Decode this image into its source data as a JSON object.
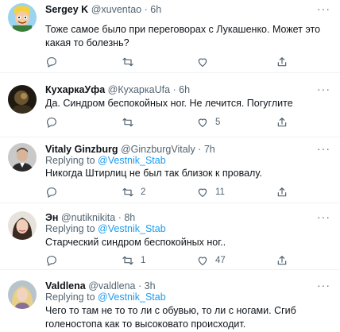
{
  "tweets": [
    {
      "name": "Sergey K",
      "handle": "@xuventao",
      "time": "6h",
      "replying_prefix": null,
      "replying_to": null,
      "text": "Тоже самое было при переговорах с Лукашенко. Может это какая то болезнь?",
      "avatar_icon": "cartoon-avatar",
      "counts": {
        "replies": "",
        "retweets": "",
        "likes": ""
      }
    },
    {
      "name": "КухаркаУфа",
      "handle": "@КухаркаUfa",
      "time": "6h",
      "replying_prefix": null,
      "replying_to": null,
      "text": "Да. Синдром беспокойных ног. Не лечится. Погуглите",
      "avatar_icon": "dark-photo-avatar",
      "counts": {
        "replies": "",
        "retweets": "",
        "likes": "5"
      }
    },
    {
      "name": "Vitaly Ginzburg",
      "handle": "@GinzburgVitaly",
      "time": "7h",
      "replying_prefix": "Replying to",
      "replying_to": "@Vestnik_Stab",
      "text": "Никогда Штирлиц не был так близок к провалу.",
      "avatar_icon": "man-photo-avatar",
      "counts": {
        "replies": "",
        "retweets": "2",
        "likes": "11"
      }
    },
    {
      "name": "Эн",
      "handle": "@nutiknikita",
      "time": "8h",
      "replying_prefix": "Replying to",
      "replying_to": "@Vestnik_Stab",
      "text": "Старческий синдром беспокойных ног..",
      "avatar_icon": "woman-photo-avatar",
      "counts": {
        "replies": "",
        "retweets": "1",
        "likes": "47"
      }
    },
    {
      "name": "Valdlena",
      "handle": "@valdlena",
      "time": "3h",
      "replying_prefix": "Replying to",
      "replying_to": "@Vestnik_Stab",
      "text": "Чего то там не то то ли с обувью, то ли с ногами. Сгиб голеностопа как то высоковато происходит.",
      "avatar_icon": "blonde-photo-avatar",
      "counts": null
    }
  ],
  "colors": {
    "accent": "#1d9bf0",
    "muted": "#536471",
    "text": "#0f1419",
    "divider": "#eff3f4"
  },
  "icons": {
    "reply": "reply-icon",
    "retweet": "retweet-icon",
    "like": "like-icon",
    "share": "share-icon",
    "more": "more-icon"
  },
  "more_glyph": "···"
}
